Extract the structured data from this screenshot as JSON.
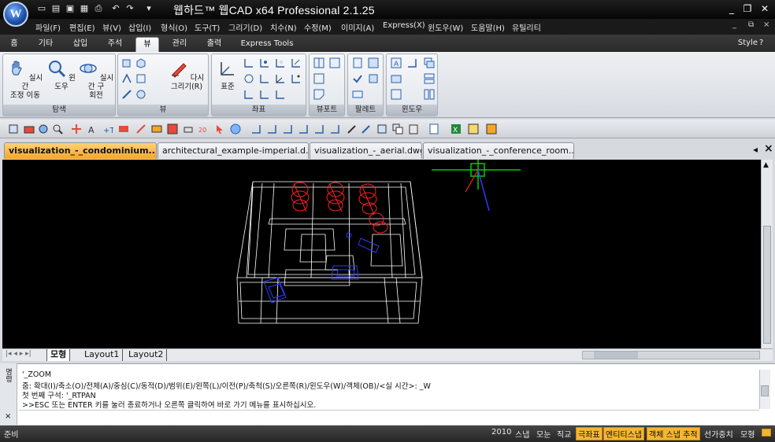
{
  "app": {
    "title": "웹하드™ 웹CAD  x64  Professional  2.1.25",
    "logo_letter": "W"
  },
  "menu": {
    "items": [
      "파일(F)",
      "편집(E)",
      "뷰(V)",
      "삽입(I)",
      "형식(O)",
      "도구(T)",
      "그리기(D)",
      "치수(N)",
      "수정(M)",
      "이미지(A)",
      "Express(X)",
      "윈도우(W)",
      "도움말(H)",
      "유틸리티"
    ],
    "window_controls": [
      "_",
      "⧉",
      "×"
    ]
  },
  "ribbon": {
    "tabs": [
      "홈",
      "기타",
      "삽입",
      "주석",
      "뷰",
      "관리",
      "출력",
      "Express Tools"
    ],
    "active_tab": "뷰",
    "style_label": "Style",
    "panels": {
      "navigate": {
        "label": "탐색",
        "realtime_pan": "실시간\n조정 이동",
        "window": "윈도우",
        "realtime_rotate": "실시간 구\n회전"
      },
      "view": {
        "label": "뷰",
        "redraw": "다시\n그리기(R)"
      },
      "ucs": {
        "label": "좌표",
        "standard": "표준"
      },
      "viewport": {
        "label": "뷰포트"
      },
      "palette": {
        "label": "팔레트"
      },
      "window": {
        "label": "윈도우"
      }
    }
  },
  "documents": {
    "tabs": [
      "visualization_-_condominium...",
      "architectural_example-imperial.d...",
      "visualization_-_aerial.dwg",
      "visualization_-_conference_room...."
    ],
    "active_index": 0,
    "close_symbol": "×"
  },
  "layouts": {
    "tabs": [
      "모형",
      "Layout1",
      "Layout2"
    ],
    "active": "모형"
  },
  "command": {
    "side_labels": [
      "명령",
      "×"
    ],
    "lines": [
      "'_ZOOM",
      "줌: 확대(I)/축소(O)/전체(A)/중심(C)/동적(D)/범위(E)/왼쪽(L)/이전(P)/축척(S)/오른쪽(R)/윈도우(W)/객체(OB)/<실 시간>: _W",
      "첫 번째 구석: '_RTPAN",
      ">>ESC 또는 ENTER 키를 눌러 종료하거나 오른쪽 클릭하여 바로 가기 메뉴를 표시하십시오."
    ]
  },
  "status": {
    "left": "준비",
    "items": [
      {
        "label": "2010",
        "on": false
      },
      {
        "label": "스냅",
        "on": false
      },
      {
        "label": "모눈",
        "on": false
      },
      {
        "label": "직교",
        "on": false
      },
      {
        "label": "극좌표",
        "on": true
      },
      {
        "label": "엔티티스냅",
        "on": true
      },
      {
        "label": "객체 스냅 추적",
        "on": true
      },
      {
        "label": "선가중치",
        "on": false
      },
      {
        "label": "모형",
        "on": false
      }
    ]
  },
  "colors": {
    "accent_tab": "#f5a623",
    "status_on": "#f6b531",
    "canvas_bg": "#000000",
    "wire_white": "#ffffff",
    "wire_red": "#ff2020",
    "wire_blue": "#2a3cff",
    "ucs_green": "#00d000"
  }
}
